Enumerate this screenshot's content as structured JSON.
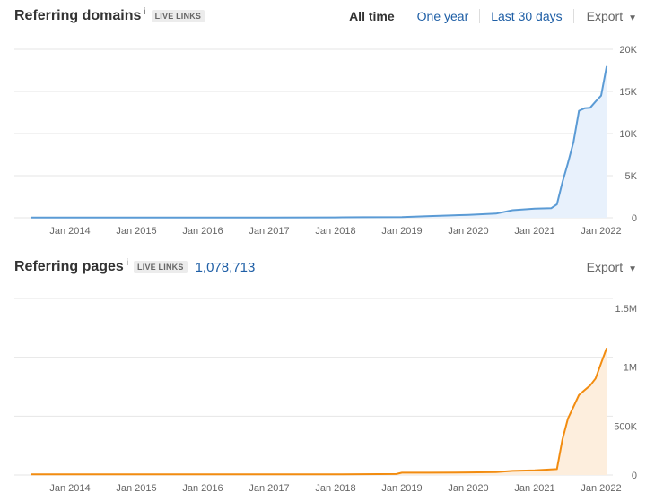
{
  "referring_domains": {
    "title": "Referring domains",
    "info_icon": "i",
    "badge": "LIVE LINKS",
    "filters": [
      "All time",
      "One year",
      "Last 30 days"
    ],
    "active_filter": "All time",
    "export_label": "Export",
    "line_color": "#5b9bd5",
    "fill_color": "#e8f1fc"
  },
  "referring_pages": {
    "title": "Referring pages",
    "info_icon": "i",
    "badge": "LIVE LINKS",
    "count": "1,078,713",
    "export_label": "Export",
    "line_color": "#f28c10",
    "fill_color": "#fdeedd"
  },
  "chart_data": [
    {
      "type": "area",
      "title": "Referring domains",
      "x_tick_labels": [
        "Jan 2014",
        "Jan 2015",
        "Jan 2016",
        "Jan 2017",
        "Jan 2018",
        "Jan 2019",
        "Jan 2020",
        "Jan 2021",
        "Jan 2022"
      ],
      "y_tick_labels": [
        "0",
        "5K",
        "10K",
        "15K",
        "20K"
      ],
      "ylim": [
        0,
        20000
      ],
      "grid": true,
      "series": [
        {
          "x": [
            "2013-06",
            "2014-01",
            "2015-01",
            "2016-01",
            "2017-01",
            "2018-01",
            "2018-06",
            "2019-01",
            "2019-06",
            "2020-01",
            "2020-06",
            "2020-09",
            "2021-01",
            "2021-04",
            "2021-05",
            "2021-06",
            "2021-07",
            "2021-08",
            "2021-09",
            "2021-10",
            "2021-11",
            "2021-12",
            "2022-01",
            "2022-02"
          ],
          "y": [
            20,
            20,
            25,
            25,
            30,
            40,
            60,
            90,
            200,
            350,
            500,
            900,
            1100,
            1150,
            1600,
            4200,
            6500,
            9000,
            12700,
            13000,
            13050,
            13800,
            14500,
            18000
          ]
        }
      ]
    },
    {
      "type": "area",
      "title": "Referring pages",
      "x_tick_labels": [
        "Jan 2014",
        "Jan 2015",
        "Jan 2016",
        "Jan 2017",
        "Jan 2018",
        "Jan 2019",
        "Jan 2020",
        "Jan 2021",
        "Jan 2022"
      ],
      "y_tick_labels": [
        "0",
        "500K",
        "1M",
        "1.5M"
      ],
      "ylim": [
        0,
        1500000
      ],
      "grid": true,
      "series": [
        {
          "x": [
            "2013-06",
            "2014-01",
            "2015-01",
            "2016-01",
            "2017-01",
            "2018-01",
            "2018-12",
            "2019-01",
            "2019-06",
            "2020-01",
            "2020-06",
            "2020-09",
            "2021-01",
            "2021-05",
            "2021-06",
            "2021-07",
            "2021-08",
            "2021-09",
            "2021-10",
            "2021-11",
            "2021-12",
            "2022-01",
            "2022-02"
          ],
          "y": [
            5000,
            5000,
            5000,
            5000,
            5000,
            5000,
            8000,
            20000,
            20000,
            22000,
            25000,
            35000,
            40000,
            50000,
            300000,
            480000,
            580000,
            680000,
            720000,
            760000,
            820000,
            950000,
            1078713
          ]
        }
      ]
    }
  ]
}
